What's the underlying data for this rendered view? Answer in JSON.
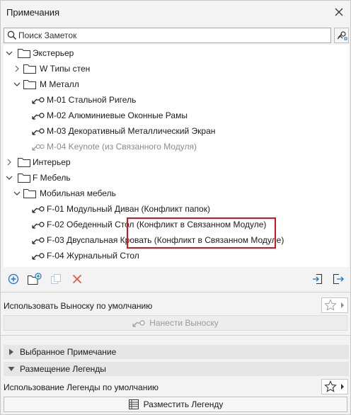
{
  "window": {
    "title": "Примечания"
  },
  "search": {
    "placeholder": "Поиск Заметок",
    "value": ""
  },
  "tree": {
    "items": [
      {
        "label": "Экстерьер",
        "type": "folder",
        "expanded": true,
        "depth": 0
      },
      {
        "label": "W Типы стен",
        "type": "folder",
        "expanded": false,
        "depth": 1
      },
      {
        "label": "M Металл",
        "type": "folder",
        "expanded": true,
        "depth": 1
      },
      {
        "label": "M-01 Стальной Ригель",
        "type": "keynote",
        "depth": 2
      },
      {
        "label": "M-02 Алюминиевые Оконные Рамы",
        "type": "keynote",
        "depth": 2
      },
      {
        "label": "M-03 Декоративный Металлический Экран",
        "type": "keynote",
        "depth": 2
      },
      {
        "label": "M-04 Keynote (из Связанного Модуля)",
        "type": "keynote-linked",
        "disabled": true,
        "depth": 2
      },
      {
        "label": "Интерьер",
        "type": "folder",
        "expanded": false,
        "depth": 0
      },
      {
        "label": "F Мебель",
        "type": "folder",
        "expanded": true,
        "depth": 0
      },
      {
        "label": "Мобильная мебель",
        "type": "folder",
        "expanded": true,
        "depth": 1
      },
      {
        "label": "F-01 Модульный Диван (Конфликт папок)",
        "type": "keynote",
        "depth": 2
      },
      {
        "label": "F-02 Обеденный Стол (Конфликт в Связанном Модуле)",
        "type": "keynote",
        "depth": 2
      },
      {
        "label": "F-03 Двуспальная Кровать (Конфликт в Связанном Модуле)",
        "type": "keynote",
        "depth": 2
      },
      {
        "label": "F-04 Журнальный Стол",
        "type": "keynote",
        "depth": 2
      }
    ]
  },
  "toolbar": {
    "buttons": [
      "add-keynote",
      "add-folder",
      "duplicate",
      "delete",
      "import",
      "export"
    ]
  },
  "placement": {
    "default_callout_label": "Использовать Выноску по умолчанию",
    "apply_callout_button": "Нанести Выноску"
  },
  "sections": {
    "selected_keynote": "Выбранное Примечание",
    "legend_placement": "Размещение Легенды"
  },
  "legend": {
    "default_legend_label": "Использование Легенды по умолчанию",
    "place_legend_button": "Разместить Легенду"
  },
  "colors": {
    "accent_blue": "#1a73c9",
    "delete_red": "#e8524a",
    "highlight_red": "#d9121f"
  }
}
